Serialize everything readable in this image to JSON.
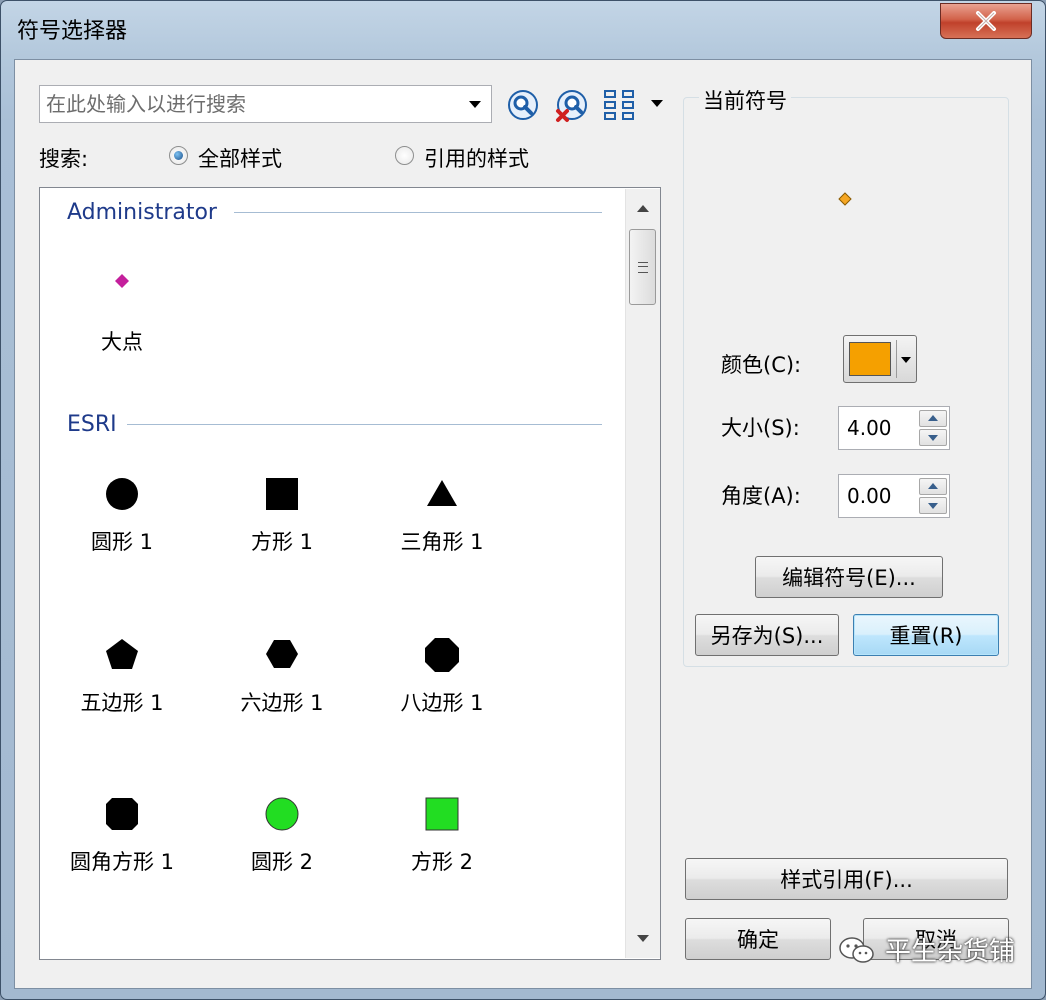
{
  "window": {
    "title": "符号选择器",
    "close_glyph": "✕"
  },
  "search": {
    "placeholder": "在此处输入以进行搜索",
    "value": ""
  },
  "toolbar": {
    "search_icon": "magnifier-icon",
    "clear_icon": "clear-search-icon",
    "view_icon": "grid-view-icon"
  },
  "scope": {
    "label": "搜索:",
    "option_all": "全部样式",
    "option_ref": "引用的样式",
    "selected": "all"
  },
  "groups": [
    {
      "title": "Administrator",
      "symbols": [
        {
          "label": "大点",
          "shape": "diamond",
          "color": "#c41f9c"
        }
      ]
    },
    {
      "title": "ESRI",
      "symbols": [
        {
          "label": "圆形 1",
          "shape": "circle",
          "color": "#000000"
        },
        {
          "label": "方形 1",
          "shape": "square",
          "color": "#000000"
        },
        {
          "label": "三角形 1",
          "shape": "triangle",
          "color": "#000000"
        },
        {
          "label": "五边形 1",
          "shape": "pentagon",
          "color": "#000000"
        },
        {
          "label": "六边形 1",
          "shape": "hexagon",
          "color": "#000000"
        },
        {
          "label": "八边形 1",
          "shape": "octagon",
          "color": "#000000"
        },
        {
          "label": "圆角方形 1",
          "shape": "rounded-square",
          "color": "#000000"
        },
        {
          "label": "圆形 2",
          "shape": "circle",
          "color": "#22dd22"
        },
        {
          "label": "方形 2",
          "shape": "square",
          "color": "#22dd22"
        }
      ]
    }
  ],
  "current": {
    "title": "当前符号",
    "preview_color": "#f5a623",
    "color_label": "颜色(C):",
    "color_value": "#f5a000",
    "size_label": "大小(S):",
    "size_value": "4.00",
    "angle_label": "角度(A):",
    "angle_value": "0.00"
  },
  "buttons": {
    "edit": "编辑符号(E)...",
    "save_as": "另存为(S)...",
    "reset": "重置(R)",
    "style_ref": "样式引用(F)...",
    "ok": "确定",
    "cancel": "取消"
  },
  "watermark": "平生杂货铺"
}
